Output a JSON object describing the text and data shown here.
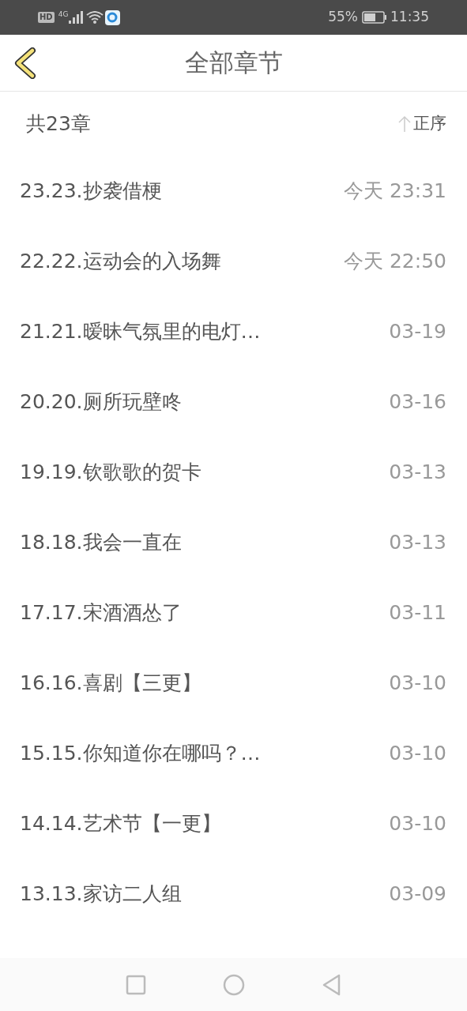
{
  "status_bar": {
    "hd": "HD",
    "network": "4G",
    "battery": "55%",
    "time": "11:35"
  },
  "header": {
    "title": "全部章节"
  },
  "summary": {
    "count": "共23章",
    "sort": "正序"
  },
  "chapters": [
    {
      "title": "23.23.抄袭借梗",
      "date": "今天 23:31"
    },
    {
      "title": "22.22.运动会的入场舞",
      "date": "今天 22:50"
    },
    {
      "title": "21.21.暧昧气氛里的电灯…",
      "date": "03-19"
    },
    {
      "title": "20.20.厕所玩壁咚",
      "date": "03-16"
    },
    {
      "title": "19.19.钦歌歌的贺卡",
      "date": "03-13"
    },
    {
      "title": "18.18.我会一直在",
      "date": "03-13"
    },
    {
      "title": "17.17.宋酒酒怂了",
      "date": "03-11"
    },
    {
      "title": "16.16.喜剧【三更】",
      "date": "03-10"
    },
    {
      "title": "15.15.你知道你在哪吗？…",
      "date": "03-10"
    },
    {
      "title": "14.14.艺术节【一更】",
      "date": "03-10"
    },
    {
      "title": "13.13.家访二人组",
      "date": "03-09"
    }
  ]
}
